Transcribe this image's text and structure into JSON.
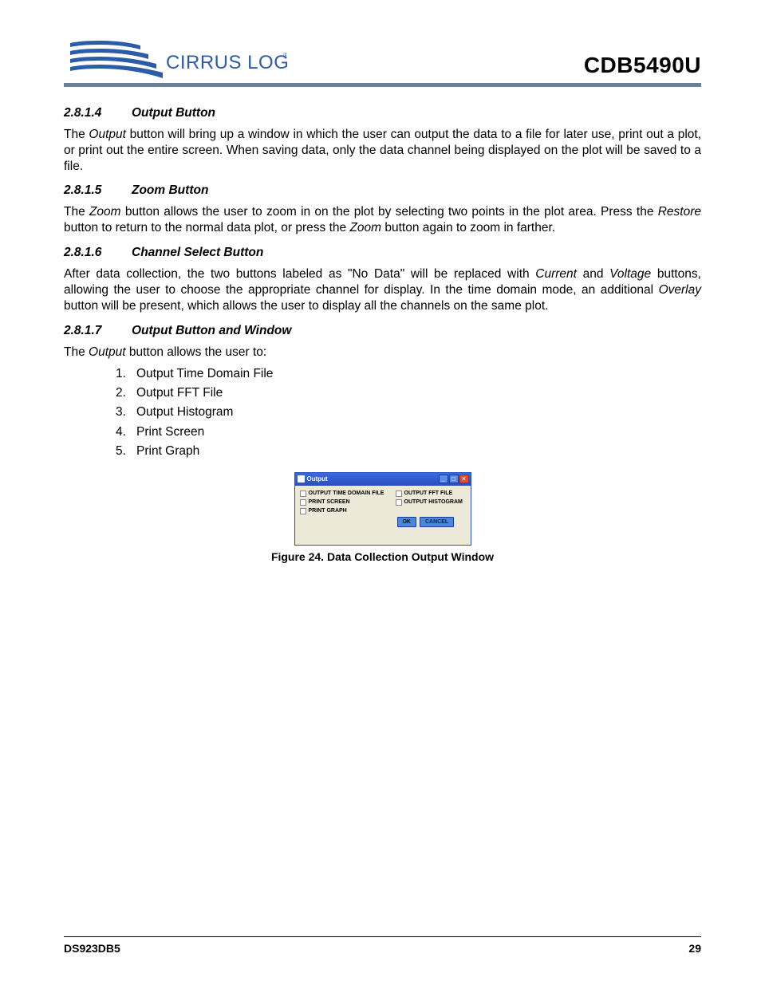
{
  "header": {
    "brand_name": "CIRRUS LOGIC",
    "doc_title": "CDB5490U"
  },
  "sections": {
    "s1": {
      "num": "2.8.1.4",
      "title": "Output Button"
    },
    "s2": {
      "num": "2.8.1.5",
      "title": "Zoom Button"
    },
    "s3": {
      "num": "2.8.1.6",
      "title": "Channel Select Button"
    },
    "s4": {
      "num": "2.8.1.7",
      "title": "Output Button and Window"
    }
  },
  "paragraphs": {
    "p1a": "The ",
    "p1b": "Output",
    "p1c": " button will bring up a window in which the user can output the data to a file for later use, print out a plot, or print out the entire screen. When saving data, only the data channel being displayed on the plot will be saved to a file.",
    "p2a": "The ",
    "p2b": "Zoom",
    "p2c": " button allows the user to zoom in on the plot by selecting two points in the plot area. Press the ",
    "p2d": "Restore",
    "p2e": " button to return to the normal data plot, or press the ",
    "p2f": "Zoom",
    "p2g": " button again to zoom in farther.",
    "p3a": "After data collection, the two buttons labeled as \"No Data\" will be replaced with ",
    "p3b": "Current",
    "p3c": " and ",
    "p3d": "Voltage",
    "p3e": " buttons, allowing the user to choose the appropriate channel for display. In the time domain mode, an additional ",
    "p3f": "Overlay",
    "p3g": " button will be present, which allows the user to display all the channels on the same plot.",
    "p4a": "The ",
    "p4b": "Output",
    "p4c": " button allows the user to:"
  },
  "list": {
    "i1": "Output Time Domain File",
    "i2": "Output FFT File",
    "i3": "Output Histogram",
    "i4": "Print Screen",
    "i5": "Print Graph"
  },
  "window": {
    "title": "Output",
    "opts": {
      "o1": "OUTPUT TIME DOMAIN FILE",
      "o2": "OUTPUT FFT FILE",
      "o3": "PRINT SCREEN",
      "o4": "OUTPUT HISTOGRAM",
      "o5": "PRINT GRAPH"
    },
    "ok": "OK",
    "cancel": "CANCEL"
  },
  "figure_caption": "Figure 24.  Data Collection Output Window",
  "footer": {
    "left": "DS923DB5",
    "right": "29"
  }
}
